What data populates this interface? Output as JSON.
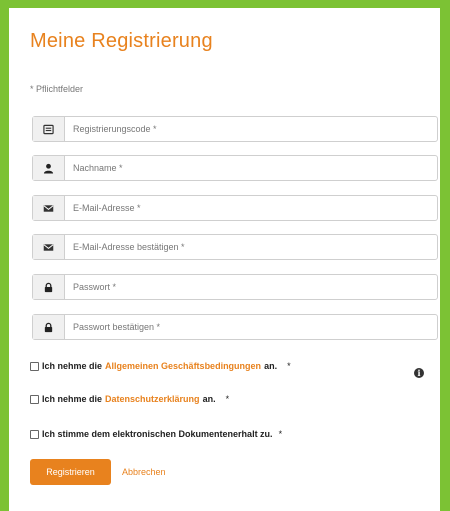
{
  "form": {
    "title": "Meine Registrierung",
    "required_note": "* Pflichtfelder",
    "fields": [
      {
        "icon": "id-card-icon",
        "placeholder": "Registrierungscode *"
      },
      {
        "icon": "user-icon",
        "placeholder": "Nachname *"
      },
      {
        "icon": "envelope-icon",
        "placeholder": "E-Mail-Adresse *"
      },
      {
        "icon": "envelope-icon",
        "placeholder": "E-Mail-Adresse bestätigen *"
      },
      {
        "icon": "lock-icon",
        "placeholder": "Passwort *"
      },
      {
        "icon": "lock-icon",
        "placeholder": "Passwort bestätigen *"
      }
    ],
    "checks": {
      "terms": {
        "before": "Ich nehme die",
        "link": "Allgemeinen Geschäftsbedingungen",
        "after": "an.",
        "star": "*"
      },
      "privacy": {
        "before": "Ich nehme die",
        "link": "Datenschutzerklärung",
        "after": "an.",
        "star": "*"
      },
      "documents": {
        "text": "Ich stimme dem elektronischen Dokumentenerhalt zu.",
        "star": "*"
      }
    },
    "info_glyph": "i",
    "register_label": "Registrieren",
    "cancel_label": "Abbrechen"
  },
  "colors": {
    "accent": "#e8821e",
    "background": "#7cc234"
  }
}
